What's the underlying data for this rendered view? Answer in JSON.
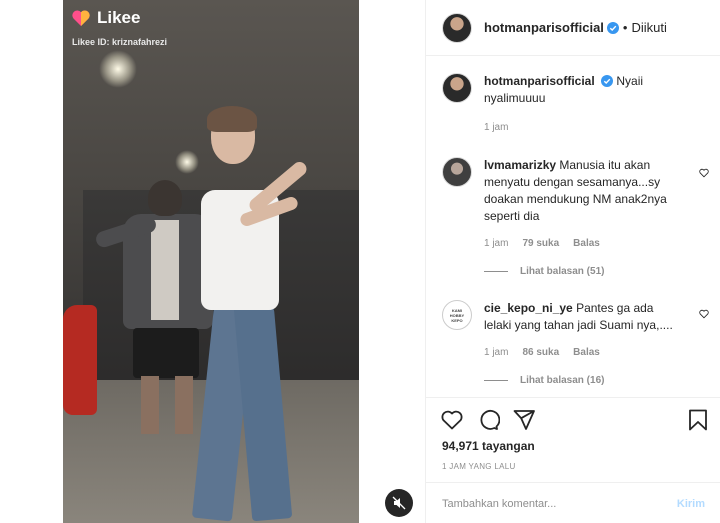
{
  "media": {
    "brand": "Likee",
    "likee_id": "Likee ID: kriznafahrezi"
  },
  "header": {
    "username": "hotmanparisofficial",
    "follow_status": "Diikuti"
  },
  "caption": {
    "username": "hotmanparisofficial",
    "text": "Nyaii nyalimuuuu",
    "time": "1 jam"
  },
  "comments": [
    {
      "username": "lvmamarizky",
      "text": "Manusia itu akan menyatu dengan sesamanya...sy doakan mendukung NM anak2nya seperti dia",
      "time": "1 jam",
      "likes": "79 suka",
      "reply": "Balas",
      "view_replies": "Lihat balasan (51)"
    },
    {
      "username": "cie_kepo_ni_ye",
      "text": "Pantes ga ada lelaki yang tahan jadi Suami nya,....",
      "time": "1 jam",
      "likes": "86 suka",
      "reply": "Balas",
      "view_replies": "Lihat balasan (16)"
    }
  ],
  "stats": {
    "views": "94,971 tayangan",
    "posted": "1 JAM YANG LALU"
  },
  "composer": {
    "placeholder": "Tambahkan komentar...",
    "post_label": "Kirim"
  },
  "colors": {
    "verified": "#3897f0",
    "secondary_text": "#8e8e8e",
    "post_button_disabled": "#b3dbff"
  }
}
